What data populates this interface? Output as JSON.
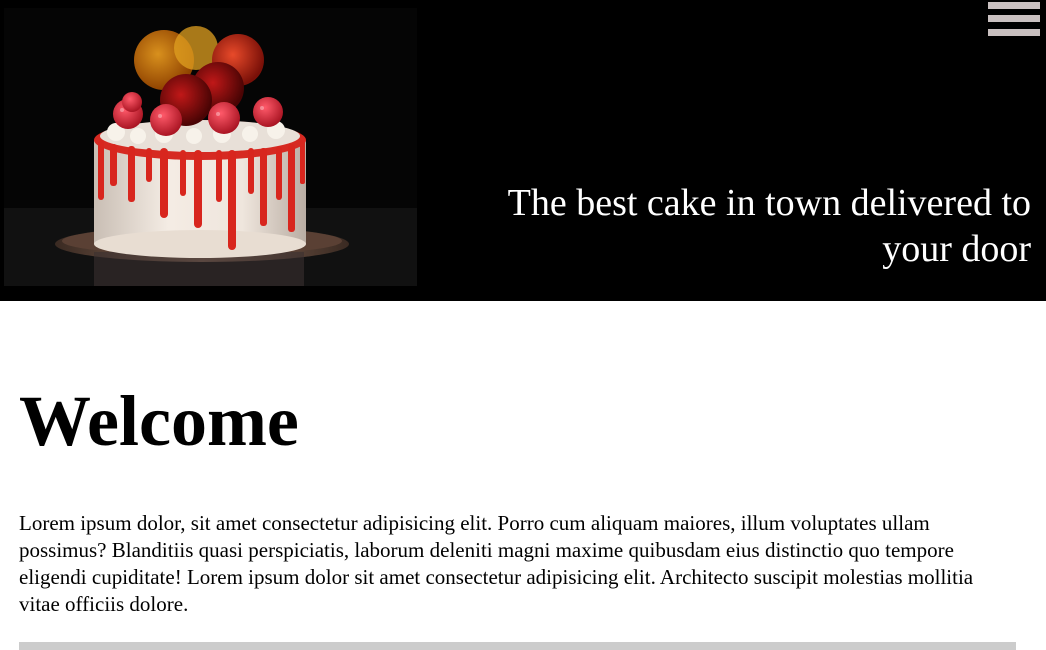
{
  "hero": {
    "image_subject": "cake with raspberries and red drip icing",
    "tagline": "The best cake in town delivered to your door",
    "background": "#000000"
  },
  "nav": {
    "menu_icon": "hamburger-menu-icon",
    "menu_color": "#c9c0c0"
  },
  "main": {
    "heading": "Welcome",
    "intro": "Lorem ipsum dolor, sit amet consectetur adipisicing elit. Porro cum aliquam maiores, illum voluptates ullam possimus? Blanditiis quasi perspiciatis, laborum deleniti magni maxime quibusdam eius distinctio quo tempore eligendi cupiditate! Lorem ipsum dolor sit amet consectetur adipisicing elit. Architecto suscipit molestias mollitia vitae officiis dolore."
  }
}
